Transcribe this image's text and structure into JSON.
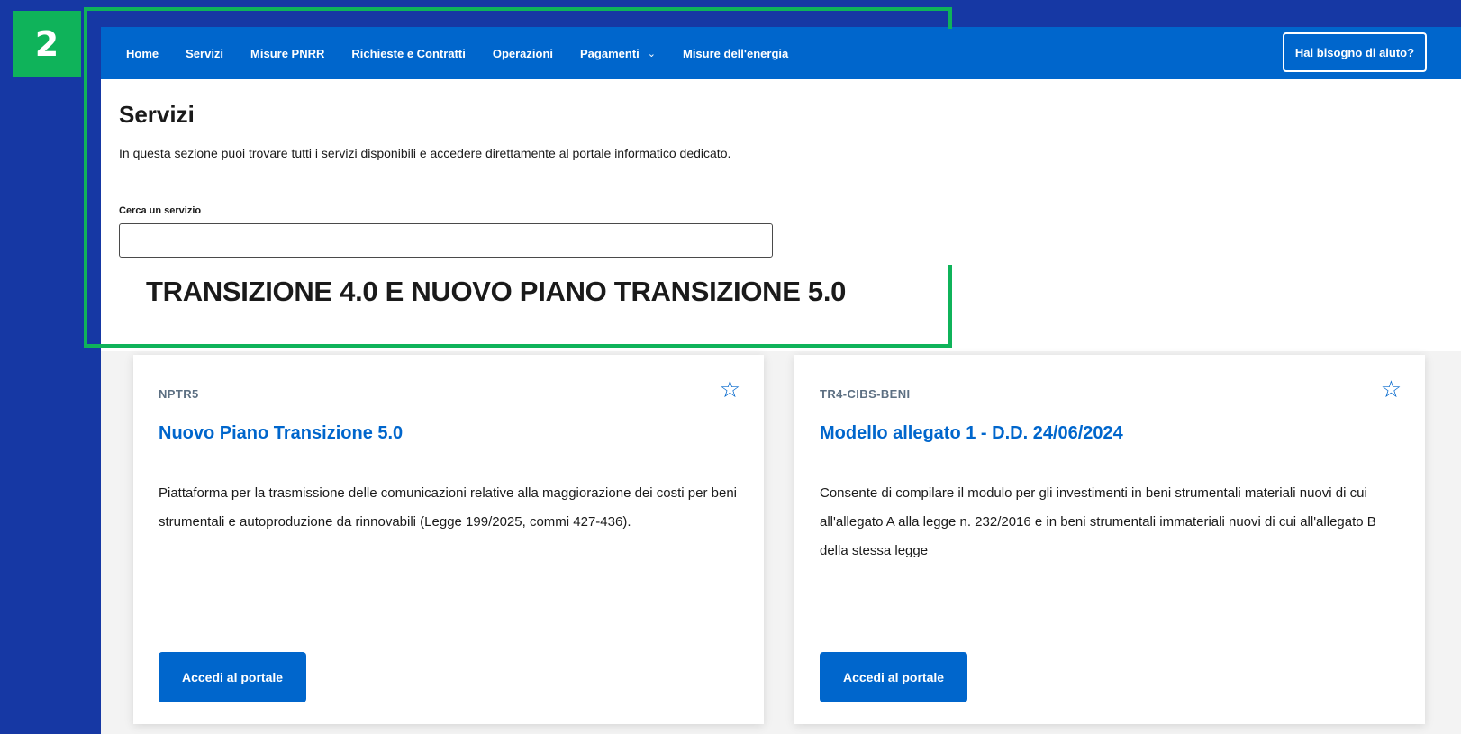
{
  "step_number": "2",
  "nav": {
    "items": [
      {
        "label": "Home"
      },
      {
        "label": "Servizi"
      },
      {
        "label": "Misure PNRR"
      },
      {
        "label": "Richieste e Contratti"
      },
      {
        "label": "Operazioni"
      },
      {
        "label": "Pagamenti",
        "has_dropdown": true
      },
      {
        "label": "Misure dell'energia"
      }
    ],
    "help_button": "Hai bisogno di aiuto?"
  },
  "page": {
    "title": "Servizi",
    "description": "In questa sezione puoi trovare tutti i servizi disponibili e accedere direttamente al portale informatico dedicato."
  },
  "search": {
    "label": "Cerca un servizio",
    "value": "",
    "placeholder": ""
  },
  "section_heading": "TRANSIZIONE 4.0 E NUOVO PIANO TRANSIZIONE 5.0",
  "cards": [
    {
      "code": "NPTR5",
      "title": "Nuovo Piano Transizione 5.0",
      "description": "Piattaforma per la trasmissione delle comunicazioni relative alla maggiorazione dei costi per beni strumentali e autoproduzione da rinnovabili (Legge 199/2025, commi 427-436).",
      "button": "Accedi al portale",
      "icon": "star-outline-icon"
    },
    {
      "code": "TR4-CIBS-BENI",
      "title": "Modello allegato 1 - D.D. 24/06/2024",
      "description": "Consente di compilare il modulo per gli investimenti in beni strumentali materiali nuovi di cui all'allegato A alla legge n. 232/2016 e in beni strumentali immateriali nuovi di cui all'allegato B della stessa legge",
      "button": "Accedi al portale",
      "icon": "star-outline-icon"
    }
  ],
  "colors": {
    "background": "#1638a4",
    "navbar": "#0066cc",
    "highlight": "#0fb35a",
    "link": "#0066cc"
  }
}
